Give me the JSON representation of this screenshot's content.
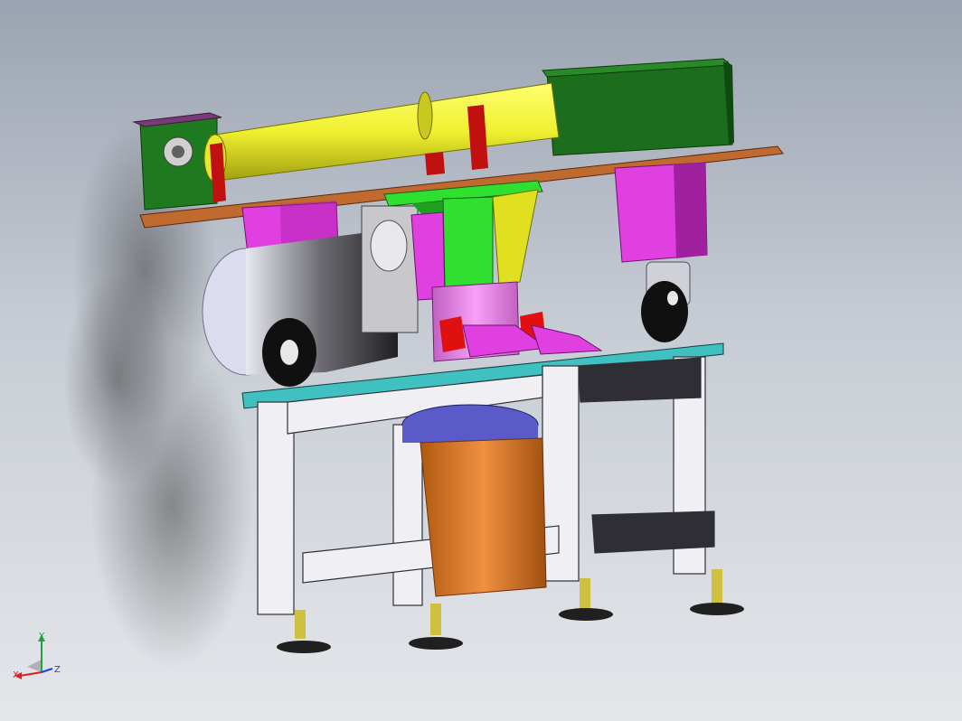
{
  "view": {
    "background_top": "#9aa3b1",
    "background_bottom": "#e4e6ea"
  },
  "axes": {
    "x_label": "X",
    "y_label": "Y",
    "z_label": "Z",
    "x_color": "#e02020",
    "y_color": "#20a040",
    "z_color": "#2040e0"
  },
  "model": {
    "parts": [
      {
        "name": "top-plate",
        "color": "#c06a30"
      },
      {
        "name": "yellow-cylinder",
        "color": "#f0f030"
      },
      {
        "name": "green-gearbox",
        "color": "#1c6e1c"
      },
      {
        "name": "magenta-blocks",
        "color": "#e040e0"
      },
      {
        "name": "green-column",
        "color": "#30e030"
      },
      {
        "name": "pink-housing",
        "color": "#f080f0"
      },
      {
        "name": "red-pins",
        "color": "#e01010"
      },
      {
        "name": "teal-plate",
        "color": "#40c0c0"
      },
      {
        "name": "white-frame",
        "color": "#f0f0f0"
      },
      {
        "name": "orange-cylinder",
        "color": "#e07a20"
      },
      {
        "name": "blue-ring",
        "color": "#5a5ac8"
      },
      {
        "name": "leveling-feet",
        "color": "#303030"
      }
    ]
  }
}
